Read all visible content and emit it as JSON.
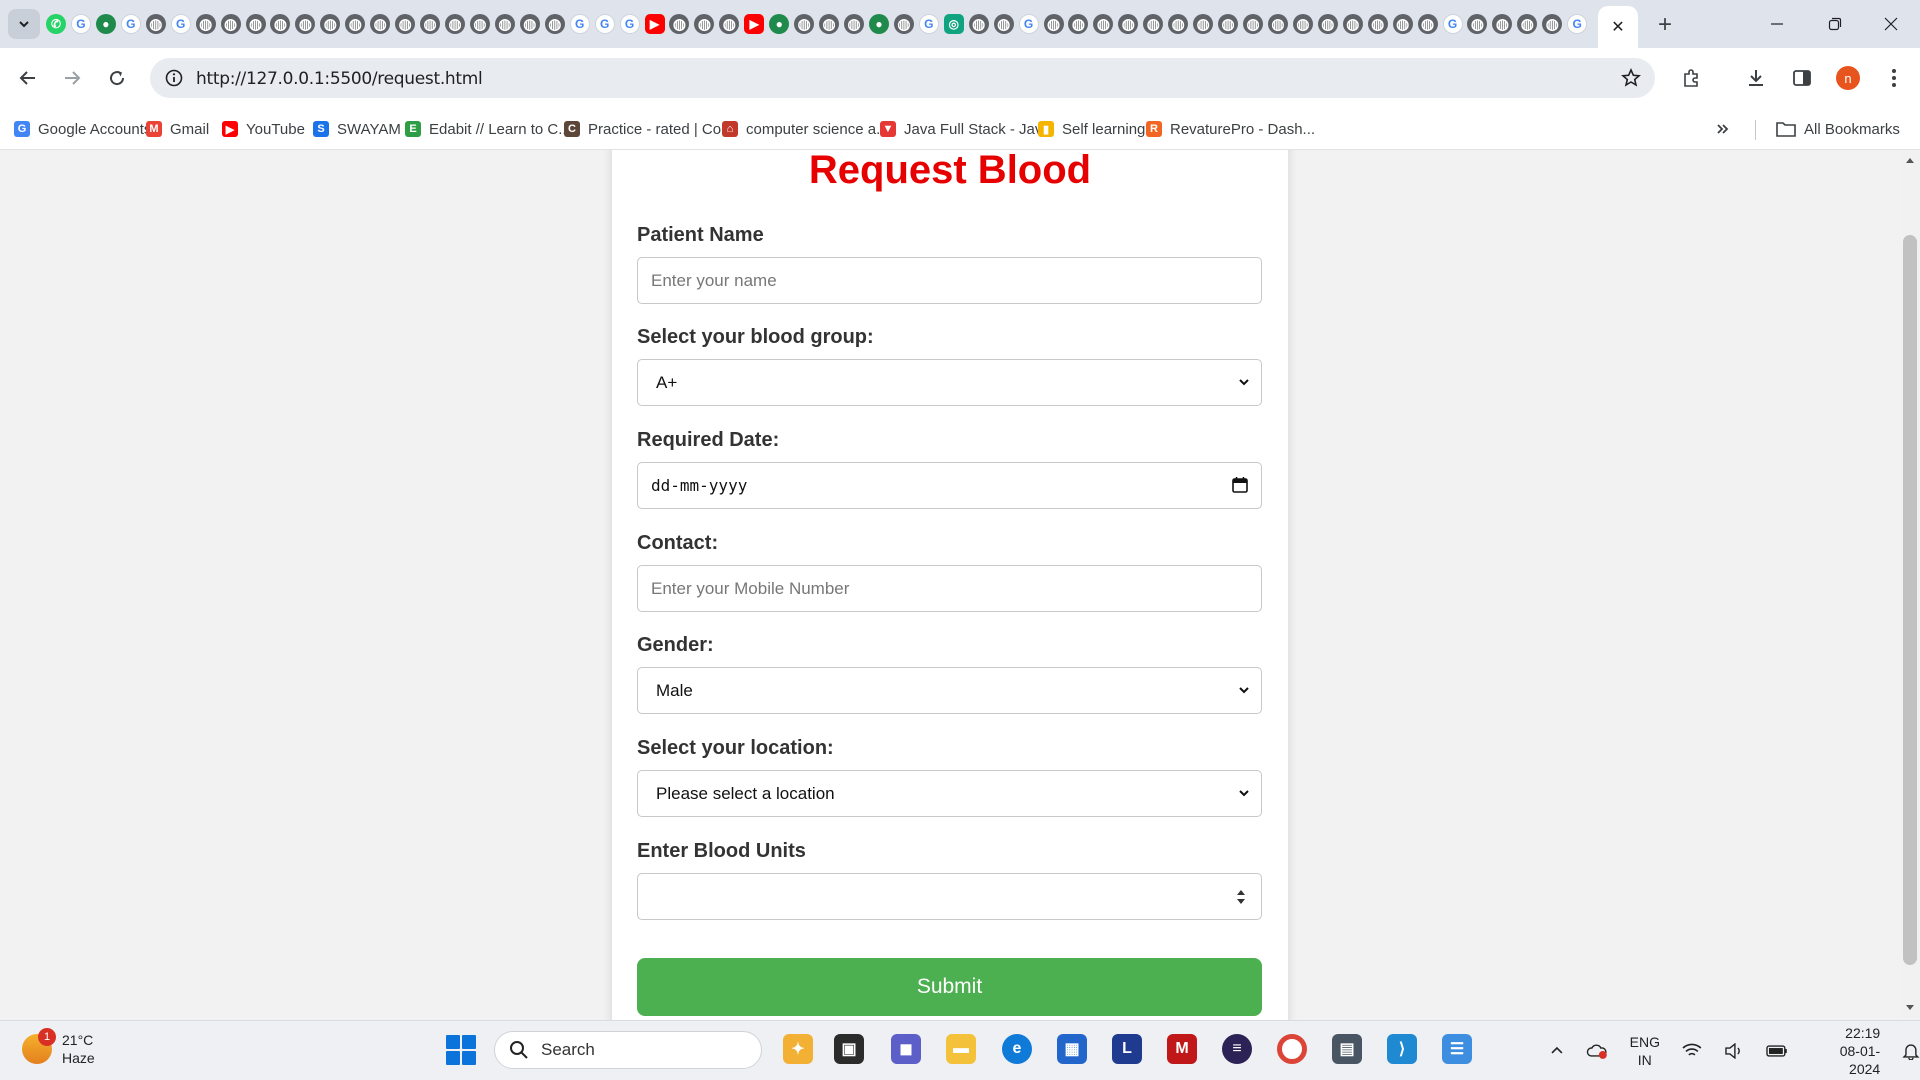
{
  "browser": {
    "url": "http://127.0.0.1:5500/request.html",
    "active_tab_close": "✕",
    "new_tab": "+",
    "profile_initial": "n",
    "tab_icons": [
      "wa",
      "g",
      "gr",
      "g",
      "globe",
      "g",
      "globe",
      "globe",
      "globe",
      "globe",
      "globe",
      "globe",
      "globe",
      "globe",
      "globe",
      "globe",
      "globe",
      "globe",
      "globe",
      "globe",
      "globe",
      "g",
      "g",
      "g",
      "yt",
      "globe",
      "globe",
      "globe",
      "yt",
      "gr",
      "globe",
      "globe",
      "globe",
      "gr",
      "globe",
      "g",
      "tl",
      "globe",
      "globe",
      "g",
      "globe",
      "globe",
      "globe",
      "globe",
      "globe",
      "globe",
      "globe",
      "globe",
      "globe",
      "globe",
      "globe",
      "globe",
      "globe",
      "globe",
      "globe",
      "globe",
      "g",
      "globe",
      "globe",
      "globe",
      "globe",
      "g"
    ]
  },
  "bookmarks": [
    {
      "label": "Google Accounts",
      "icon": "google-icon",
      "color": "#4285f4",
      "glyph": "G"
    },
    {
      "label": "Gmail",
      "icon": "gmail-icon",
      "color": "#ea4335",
      "glyph": "M"
    },
    {
      "label": "YouTube",
      "icon": "youtube-icon",
      "color": "#ff0000",
      "glyph": "▶"
    },
    {
      "label": "SWAYAM",
      "icon": "swayam-icon",
      "color": "#1a73e8",
      "glyph": "S"
    },
    {
      "label": "Edabit // Learn to C...",
      "icon": "edabit-icon",
      "color": "#2e9e46",
      "glyph": "E"
    },
    {
      "label": "Practice - rated | Co...",
      "icon": "codechef-icon",
      "color": "#5b4638",
      "glyph": "C"
    },
    {
      "label": "computer science a...",
      "icon": "home-icon",
      "color": "#c0392b",
      "glyph": "⌂"
    },
    {
      "label": "Java Full Stack - Jav...",
      "icon": "triangle-icon",
      "color": "#e53935",
      "glyph": "▼"
    },
    {
      "label": "Self learning",
      "icon": "bars-icon",
      "color": "#f4b400",
      "glyph": "▮"
    },
    {
      "label": "RevaturePro - Dash...",
      "icon": "revature-icon",
      "color": "#f26522",
      "glyph": "R"
    }
  ],
  "all_bookmarks_label": "All Bookmarks",
  "form": {
    "title": "Request Blood",
    "patient_name_label": "Patient Name",
    "patient_name_placeholder": "Enter your name",
    "blood_group_label": "Select your blood group:",
    "blood_group_value": "A+",
    "date_label": "Required Date:",
    "date_placeholder": "dd-mm-yyyy",
    "contact_label": "Contact:",
    "contact_placeholder": "Enter your Mobile Number",
    "gender_label": "Gender:",
    "gender_value": "Male",
    "location_label": "Select your location:",
    "location_value": "Please select a location",
    "units_label": "Enter Blood Units",
    "units_value": "",
    "submit_label": "Submit"
  },
  "taskbar": {
    "weather_temp": "21°C",
    "weather_desc": "Haze",
    "weather_badge": "1",
    "search_label": "Search",
    "lang_top": "ENG",
    "lang_bottom": "IN",
    "time": "22:19",
    "date": "08-01-2024"
  }
}
